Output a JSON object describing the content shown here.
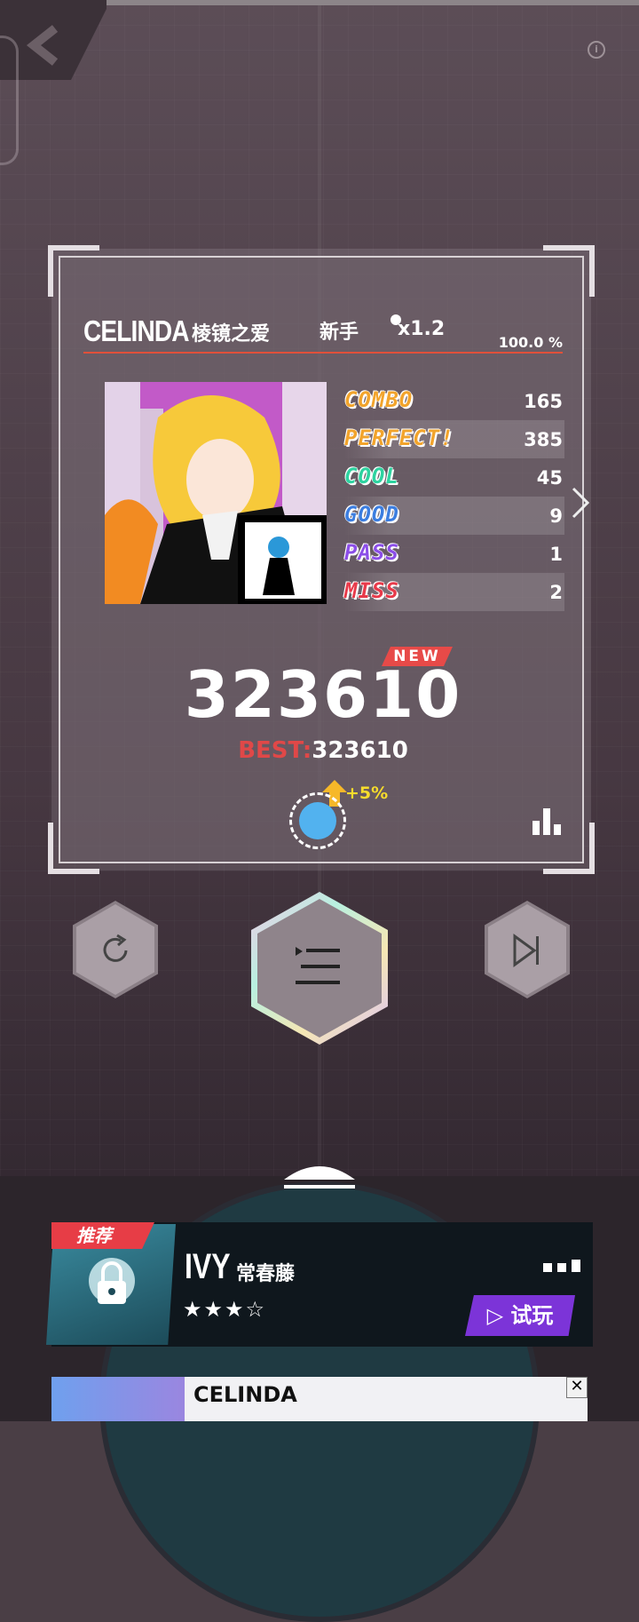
{
  "result": {
    "artist": "CELINDA",
    "song": "棱镜之爱",
    "difficulty": "新手",
    "speed": "x1.2",
    "accuracy": "100.0 %",
    "stats": [
      {
        "label": "COMBO",
        "value": "165",
        "color": "#f2a42c"
      },
      {
        "label": "PERFECT!",
        "value": "385",
        "color": "#f2a42c"
      },
      {
        "label": "COOL",
        "value": "45",
        "color": "#2ed3a0"
      },
      {
        "label": "GOOD",
        "value": "9",
        "color": "#3c7ee0"
      },
      {
        "label": "PASS",
        "value": "1",
        "color": "#8c4ee8"
      },
      {
        "label": "MISS",
        "value": "2",
        "color": "#e83a4a"
      }
    ],
    "new_badge": "NEW",
    "score": "323610",
    "best_label": "BEST:",
    "best_value": "323610",
    "bonus": "+5%"
  },
  "recommend": {
    "tag": "推荐",
    "title": "IVY",
    "subtitle": "常春藤",
    "stars": "★★★☆",
    "try_label": "▷ 试玩"
  },
  "ad": {
    "title": "CELINDA",
    "close": "✕"
  },
  "icons": {
    "back": "back-icon",
    "info": "info-icon",
    "retry": "retry-icon",
    "menu": "menu-icon",
    "next": "next-track-icon",
    "chart": "bar-chart-icon",
    "expand": "chevron-right-icon",
    "collapse": "collapse-icon"
  }
}
